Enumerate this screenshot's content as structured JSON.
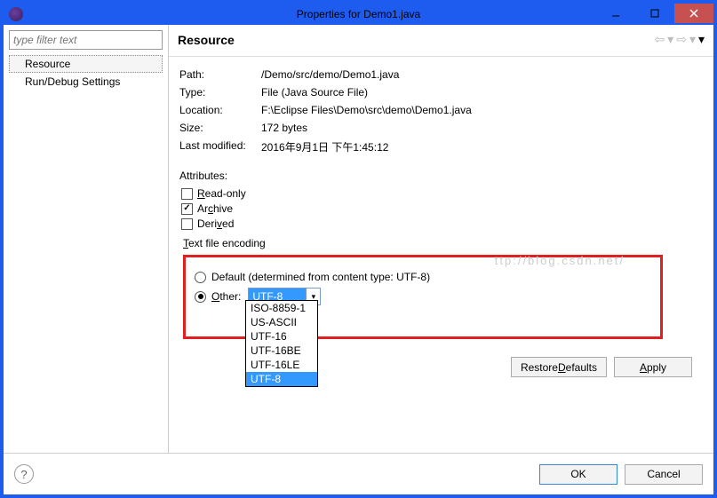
{
  "window": {
    "title": "Properties for Demo1.java"
  },
  "sidebar": {
    "filter_placeholder": "type filter text",
    "items": [
      "Resource",
      "Run/Debug Settings"
    ],
    "selected_index": 0
  },
  "header": {
    "title": "Resource"
  },
  "info": {
    "path_label": "Path:",
    "path_value": "/Demo/src/demo/Demo1.java",
    "type_label": "Type:",
    "type_value": "File  (Java Source File)",
    "location_label": "Location:",
    "location_value": "F:\\Eclipse Files\\Demo\\src\\demo\\Demo1.java",
    "size_label": "Size:",
    "size_value": "172  bytes",
    "modified_label": "Last modified:",
    "modified_value": "2016年9月1日 下午1:45:12"
  },
  "attributes": {
    "label": "Attributes:",
    "readonly": {
      "label": "Read-only",
      "checked": false
    },
    "archive": {
      "label": "Archive",
      "checked": true
    },
    "derived": {
      "label": "Derived",
      "checked": false
    }
  },
  "encoding": {
    "legend": "Text file encoding",
    "default_label": "Default (determined from content type: UTF-8)",
    "other_label": "Other:",
    "selected_value": "UTF-8",
    "options": [
      "ISO-8859-1",
      "US-ASCII",
      "UTF-16",
      "UTF-16BE",
      "UTF-16LE",
      "UTF-8"
    ],
    "selected_option_index": 5
  },
  "buttons": {
    "restore": "Restore Defaults",
    "apply": "Apply",
    "ok": "OK",
    "cancel": "Cancel"
  },
  "watermark": "ttp://blog.csdn.net/"
}
